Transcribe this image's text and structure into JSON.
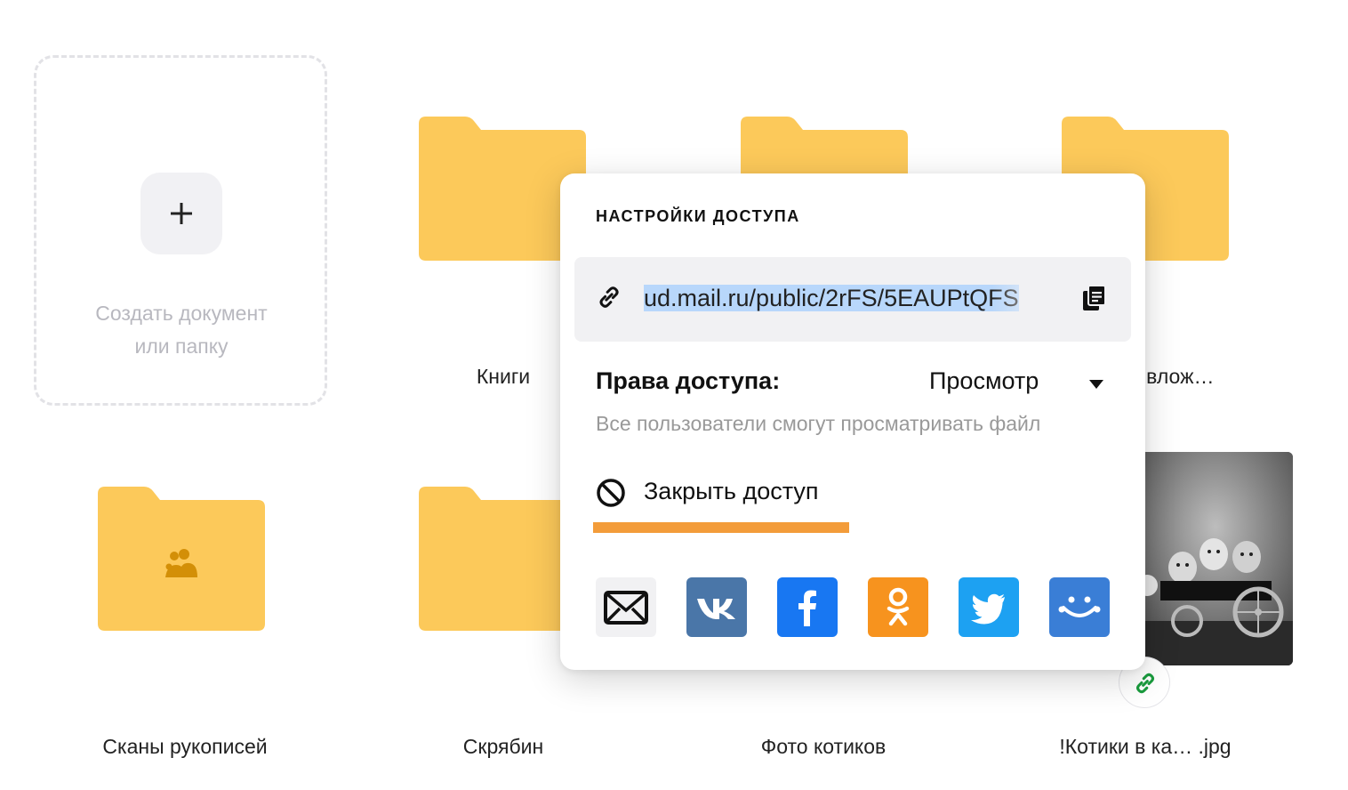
{
  "create": {
    "label_line1": "Создать документ",
    "label_line2": "или папку"
  },
  "folders": [
    {
      "name": "Книги"
    },
    {
      "name": "е влож…"
    },
    {
      "name": "Сканы рукописей"
    },
    {
      "name": "Скрябин"
    },
    {
      "name": "Фото котиков"
    },
    {
      "name": "!Котики в ка… .jpg"
    }
  ],
  "popup": {
    "title": "НАСТРОЙКИ ДОСТУПА",
    "link_selected": "ud.mail.ru/public/2rFS/5EAUPtQFS",
    "rights_label": "Права доступа:",
    "rights_value": "Просмотр",
    "rights_hint": "Все пользователи смогут просматривать файл",
    "close_access": "Закрыть доступ",
    "share_services": [
      "mail-icon",
      "vk-icon",
      "facebook-icon",
      "odnoklassniki-icon",
      "twitter-icon",
      "myworld-icon"
    ]
  },
  "colors": {
    "folder": "#fcc95a",
    "accent_orange": "#f39c3a",
    "vk": "#4a76a8",
    "facebook": "#1877f2",
    "ok": "#f7931e",
    "twitter": "#1da1f2",
    "myworld": "#3a7ed6",
    "selection": "#b8d7fb"
  }
}
